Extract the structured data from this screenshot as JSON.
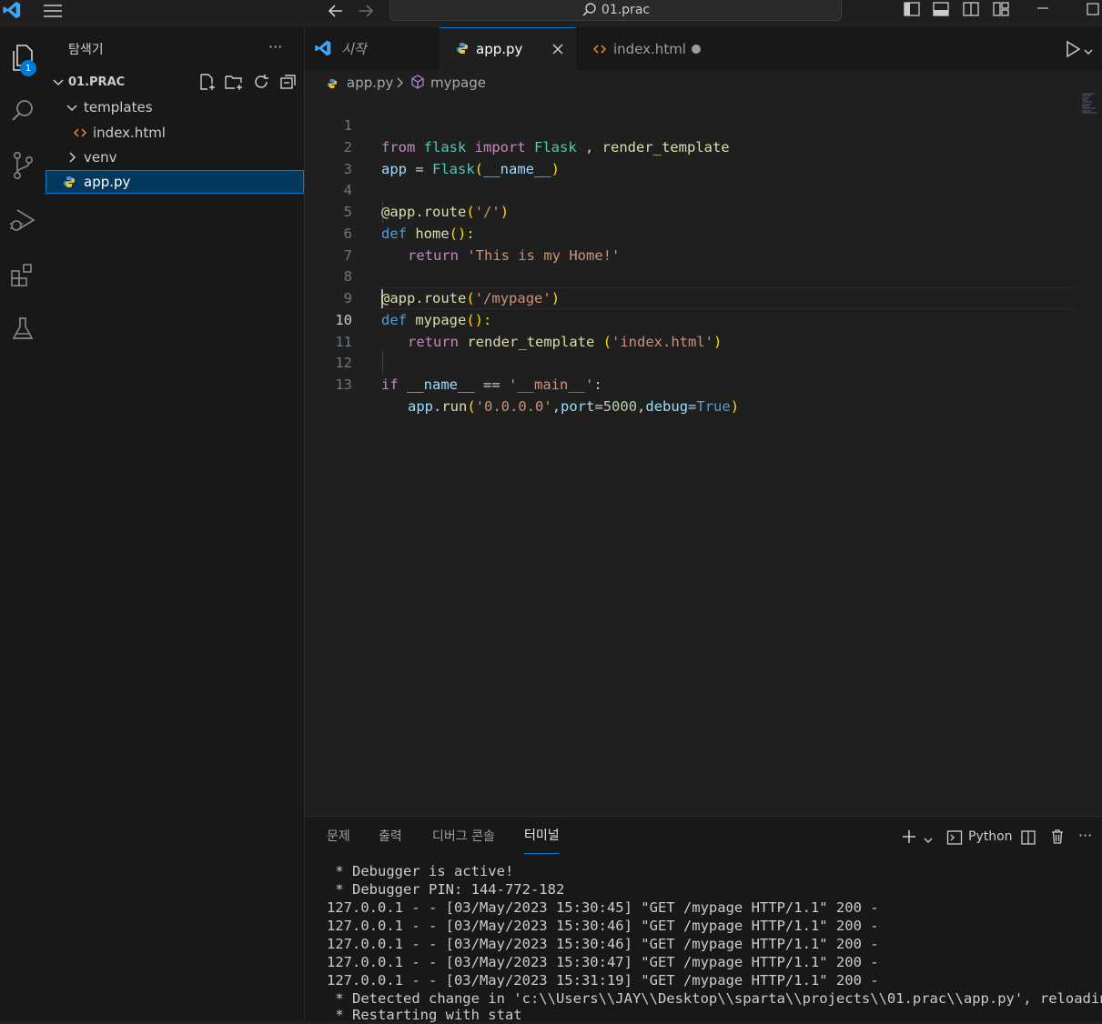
{
  "title_bar": {
    "search": "01.prac"
  },
  "activity": {
    "explorer_badge": "1"
  },
  "sidebar": {
    "title": "탐색기",
    "more": "···",
    "folder": "01.PRAC",
    "tree": [
      {
        "label": "templates"
      },
      {
        "label": "index.html"
      },
      {
        "label": "venv"
      },
      {
        "label": "app.py"
      }
    ]
  },
  "tabs": [
    {
      "label": "시작"
    },
    {
      "label": "app.py"
    },
    {
      "label": "index.html"
    }
  ],
  "breadcrumb": {
    "file": "app.py",
    "symbol": "mypage"
  },
  "editor": {
    "lines": [
      {
        "n": "1"
      },
      {
        "n": "2"
      },
      {
        "n": "3"
      },
      {
        "n": "4"
      },
      {
        "n": "5"
      },
      {
        "n": "6"
      },
      {
        "n": "7"
      },
      {
        "n": "8"
      },
      {
        "n": "9"
      },
      {
        "n": "10"
      },
      {
        "n": "11"
      },
      {
        "n": "12"
      },
      {
        "n": "13"
      }
    ],
    "tokens": {
      "l1": [
        "from",
        " flask ",
        "import",
        " Flask ",
        ", ",
        "render_template"
      ],
      "l2": [
        "app",
        " = ",
        "Flask",
        "(",
        "__name__",
        ")"
      ],
      "l4": [
        "@",
        "app",
        ".",
        "route",
        "(",
        "'/'",
        ")"
      ],
      "l5": [
        "def",
        " ",
        "home",
        "():"
      ],
      "l6": [
        "return",
        " ",
        "'This is my Home!'"
      ],
      "l8": [
        "@",
        "app",
        ".",
        "route",
        "(",
        "'/mypage'",
        ")"
      ],
      "l9": [
        "def",
        " ",
        "mypage",
        "():"
      ],
      "l10": [
        "return",
        " ",
        "render_template",
        " (",
        "'index.html'",
        ")"
      ],
      "l12": [
        "if",
        " ",
        "__name__",
        " == ",
        "'__main__'",
        ":"
      ],
      "l13": [
        "app",
        ".",
        "run",
        "(",
        "'0.0.0.0'",
        ",",
        "port",
        "=",
        "5000",
        ",",
        "debug",
        "=",
        "True",
        ")"
      ]
    }
  },
  "panel": {
    "tabs": [
      "문제",
      "출력",
      "디버그 콘솔",
      "터미널"
    ],
    "terminal_name": "Python",
    "more": "···",
    "terminal_lines": [
      " * Debugger is active!",
      " * Debugger PIN: 144-772-182",
      "127.0.0.1 - - [03/May/2023 15:30:45] \"GET /mypage HTTP/1.1\" 200 -",
      "127.0.0.1 - - [03/May/2023 15:30:46] \"GET /mypage HTTP/1.1\" 200 -",
      "127.0.0.1 - - [03/May/2023 15:30:46] \"GET /mypage HTTP/1.1\" 200 -",
      "127.0.0.1 - - [03/May/2023 15:30:47] \"GET /mypage HTTP/1.1\" 200 -",
      "127.0.0.1 - - [03/May/2023 15:31:19] \"GET /mypage HTTP/1.1\" 200 -",
      " * Detected change in 'c:\\\\Users\\\\JAY\\\\Desktop\\\\sparta\\\\projects\\\\01.prac\\\\app.py', reloading",
      " * Restarting with stat"
    ]
  }
}
